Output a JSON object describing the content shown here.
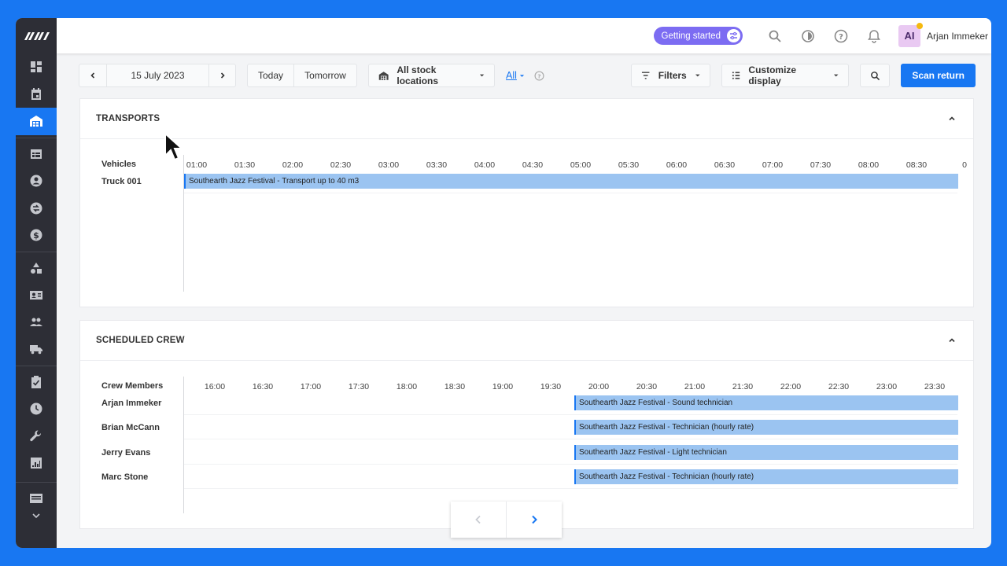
{
  "topbar": {
    "getting_started": "Getting started",
    "user_initials": "AI",
    "user_name": "Arjan Immeker"
  },
  "toolbar": {
    "date": "15 July 2023",
    "today": "Today",
    "tomorrow": "Tomorrow",
    "stock_locations": "All stock locations",
    "all_link": "All",
    "filters": "Filters",
    "customize": "Customize display",
    "scan_return": "Scan return"
  },
  "transports": {
    "title": "TRANSPORTS",
    "column_header": "Vehicles",
    "ticks": [
      "01:00",
      "01:30",
      "02:00",
      "02:30",
      "03:00",
      "03:30",
      "04:00",
      "04:30",
      "05:00",
      "05:30",
      "06:00",
      "06:30",
      "07:00",
      "07:30",
      "08:00",
      "08:30",
      "0"
    ],
    "rows": [
      {
        "label": "Truck 001",
        "bar": "Southearth Jazz Festival - Transport up to 40 m3"
      }
    ]
  },
  "crew": {
    "title": "SCHEDULED CREW",
    "column_header": "Crew Members",
    "ticks": [
      "16:00",
      "16:30",
      "17:00",
      "17:30",
      "18:00",
      "18:30",
      "19:00",
      "19:30",
      "20:00",
      "20:30",
      "21:00",
      "21:30",
      "22:00",
      "22:30",
      "23:00",
      "23:30"
    ],
    "rows": [
      {
        "label": "Arjan Immeker",
        "bar": "Southearth Jazz Festival - Sound technician"
      },
      {
        "label": "Brian McCann",
        "bar": "Southearth Jazz Festival - Technician (hourly rate)"
      },
      {
        "label": "Jerry Evans",
        "bar": "Southearth Jazz Festival - Light technician"
      },
      {
        "label": "Marc Stone",
        "bar": "Southearth Jazz Festival - Technician (hourly rate)"
      }
    ]
  },
  "colors": {
    "accent": "#1877f2",
    "bar": "#9bc4f1",
    "sidebar": "#2d2e36",
    "getting_started": "#7c6cf2"
  }
}
